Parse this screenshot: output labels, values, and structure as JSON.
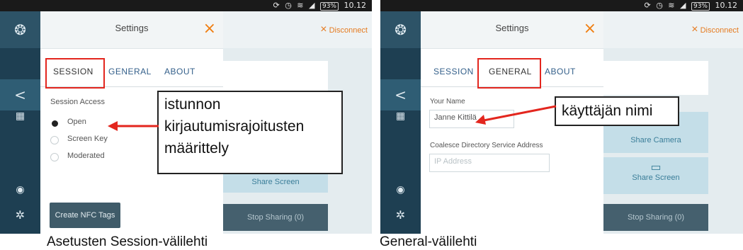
{
  "status_bar": {
    "icons": [
      "sync-icon",
      "alarm-icon",
      "wifi-icon",
      "signal-icon"
    ],
    "battery": "93%",
    "time": "10.12"
  },
  "settings": {
    "title": "Settings",
    "close_icon": "×",
    "tabs": {
      "session": "SESSION",
      "general": "GENERAL",
      "about": "ABOUT"
    },
    "session": {
      "access_label": "Session Access",
      "options": [
        "Open",
        "Screen Key",
        "Moderated"
      ],
      "selected": "Open",
      "nfc_button": "Create NFC Tags"
    },
    "general": {
      "name_label": "Your Name",
      "name_value": "Janne Kittilä",
      "address_label": "Coalesce Directory Service Address",
      "address_placeholder": "IP Address"
    }
  },
  "content": {
    "disconnect": "Disconnect",
    "share_camera": "Share Camera",
    "share_screen": "Share Screen",
    "stop_sharing": "Stop Sharing (0)"
  },
  "annotations": {
    "left_callout": [
      "istunnon",
      "kirjautumisrajoitusten",
      "määrittely"
    ],
    "right_callout": "käyttäjän nimi",
    "left_caption": "Asetusten Session-välilehti",
    "right_caption": "General-välilehti"
  },
  "colors": {
    "accent_orange": "#f07f12",
    "highlight_red": "#e3261e",
    "rail_dark": "#1e3f52"
  }
}
